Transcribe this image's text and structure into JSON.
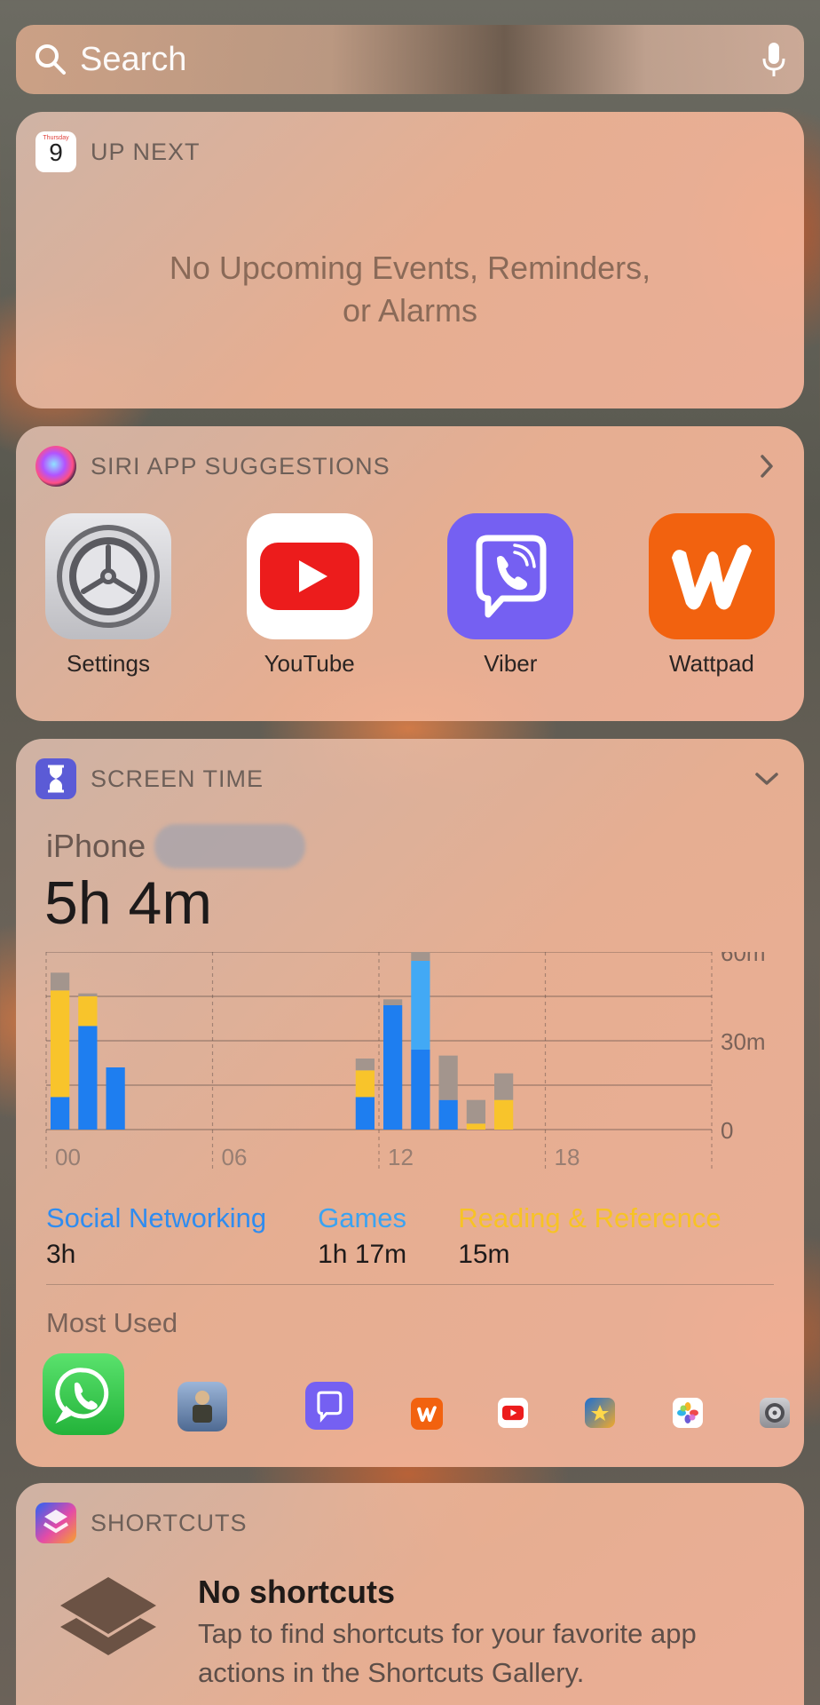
{
  "search": {
    "placeholder": "Search"
  },
  "up_next": {
    "title": "UP NEXT",
    "calendar_weekday": "Thursday",
    "calendar_day": "9",
    "message_line1": "No Upcoming Events, Reminders,",
    "message_line2": "or Alarms"
  },
  "siri": {
    "title": "SIRI APP SUGGESTIONS",
    "apps": [
      {
        "label": "Settings",
        "icon": "settings-icon"
      },
      {
        "label": "YouTube",
        "icon": "youtube-icon"
      },
      {
        "label": "Viber",
        "icon": "viber-icon"
      },
      {
        "label": "Wattpad",
        "icon": "wattpad-icon"
      }
    ]
  },
  "screen_time": {
    "title": "SCREEN TIME",
    "device": "iPhone",
    "total": "5h 4m",
    "categories": [
      {
        "name": "Social Networking",
        "value": "3h",
        "color": "#2f8cf0"
      },
      {
        "name": "Games",
        "value": "1h 17m",
        "color": "#3aa3f2"
      },
      {
        "name": "Reading & Reference",
        "value": "15m",
        "color": "#f7c325"
      }
    ],
    "most_used_label": "Most Used",
    "most_used": [
      "whatsapp-icon",
      "pubg-icon",
      "viber-icon",
      "wattpad-icon",
      "youtube-icon",
      "game-icon",
      "photos-icon",
      "settings-icon"
    ]
  },
  "chart_data": {
    "type": "bar",
    "stacked": true,
    "x_ticks": [
      "00",
      "06",
      "12",
      "18"
    ],
    "y_ticks": [
      "60m",
      "30m",
      "0"
    ],
    "ylim": [
      0,
      60
    ],
    "series_colors": {
      "social": "#1e7ef0",
      "games": "#42a9f5",
      "reading": "#f8c42b",
      "other": "#a3958d"
    },
    "hours": [
      {
        "hour": 0,
        "social": 11,
        "games": 0,
        "reading": 36,
        "other": 6
      },
      {
        "hour": 1,
        "social": 35,
        "games": 0,
        "reading": 10,
        "other": 1
      },
      {
        "hour": 2,
        "social": 21,
        "games": 0,
        "reading": 0,
        "other": 0
      },
      {
        "hour": 11,
        "social": 11,
        "games": 0,
        "reading": 9,
        "other": 4
      },
      {
        "hour": 12,
        "social": 42,
        "games": 0,
        "reading": 0,
        "other": 2
      },
      {
        "hour": 13,
        "social": 27,
        "games": 30,
        "reading": 0,
        "other": 3
      },
      {
        "hour": 14,
        "social": 10,
        "games": 0,
        "reading": 0,
        "other": 15
      },
      {
        "hour": 15,
        "social": 0,
        "games": 0,
        "reading": 2,
        "other": 8
      },
      {
        "hour": 16,
        "social": 0,
        "games": 0,
        "reading": 10,
        "other": 9
      }
    ]
  },
  "shortcuts": {
    "title": "SHORTCUTS",
    "heading": "No shortcuts",
    "description": "Tap to find shortcuts for your favorite app actions in the Shortcuts Gallery."
  }
}
